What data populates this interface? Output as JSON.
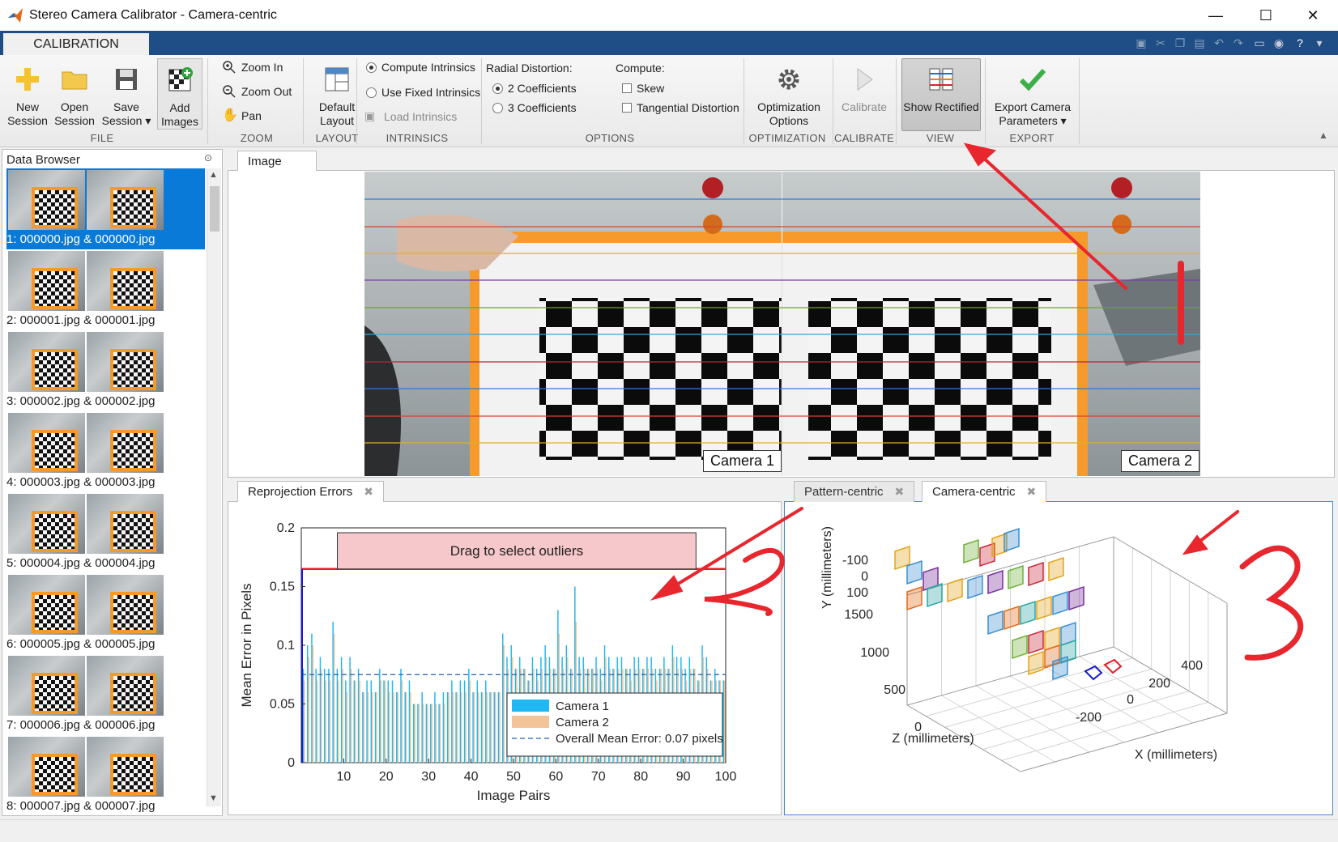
{
  "window": {
    "title": "Stereo Camera Calibrator - Camera-centric",
    "controls": [
      "—",
      "☐",
      "✕"
    ]
  },
  "ribbon": {
    "tab": "CALIBRATION",
    "file": {
      "new": [
        "New",
        "Session"
      ],
      "open": [
        "Open",
        "Session"
      ],
      "save": [
        "Save",
        "Session ▾"
      ],
      "add": [
        "Add",
        "Images"
      ],
      "section": "FILE"
    },
    "zoom": {
      "in": "Zoom In",
      "out": "Zoom Out",
      "pan": "Pan",
      "section": "ZOOM"
    },
    "layout": {
      "default": [
        "Default",
        "Layout"
      ],
      "section": "LAYOUT"
    },
    "intrinsics": {
      "compute": "Compute Intrinsics",
      "fixed": "Use Fixed Intrinsics",
      "load": "Load Intrinsics",
      "section": "INTRINSICS"
    },
    "options": {
      "radial": "Radial Distortion:",
      "coef2": "2 Coefficients",
      "coef3": "3 Coefficients",
      "compute": "Compute:",
      "skew": "Skew",
      "tangential": "Tangential Distortion",
      "section": "OPTIONS"
    },
    "optimization": {
      "label": [
        "Optimization",
        "Options"
      ],
      "section": "OPTIMIZATION"
    },
    "calibrate": {
      "label": "Calibrate",
      "section": "CALIBRATE"
    },
    "view": {
      "label": "Show Rectified",
      "section": "VIEW"
    },
    "export": {
      "label": [
        "Export Camera",
        "Parameters ▾"
      ],
      "section": "EXPORT"
    }
  },
  "data_browser": {
    "title": "Data Browser",
    "items": [
      "1: 000000.jpg & 000000.jpg",
      "2: 000001.jpg & 000001.jpg",
      "3: 000002.jpg & 000002.jpg",
      "4: 000003.jpg & 000003.jpg",
      "5: 000004.jpg & 000004.jpg",
      "6: 000005.jpg & 000005.jpg",
      "7: 000006.jpg & 000006.jpg",
      "8: 000007.jpg & 000007.jpg"
    ]
  },
  "image_panel": {
    "tab": "Image",
    "camera1": "Camera 1",
    "camera2": "Camera 2"
  },
  "reprojection": {
    "tab": "Reprojection Errors",
    "close": "✖",
    "drag": "Drag to select outliers",
    "ylabel": "Mean Error in Pixels",
    "xlabel": "Image Pairs",
    "legend": [
      "Camera 1",
      "Camera 2",
      "Overall Mean Error: 0.07 pixels"
    ],
    "yticks": [
      "0.2",
      "0.15",
      "0.1",
      "0.05",
      "0"
    ],
    "xticks": [
      "10",
      "20",
      "30",
      "40",
      "50",
      "60",
      "70",
      "80",
      "90",
      "100"
    ]
  },
  "extrinsics": {
    "tab_pattern": "Pattern-centric",
    "tab_camera": "Camera-centric",
    "close": "✖",
    "ylabel": "Y (millimeters)",
    "zlabel": "Z (millimeters)",
    "xlabel": "X (millimeters)",
    "yticks": [
      "-100",
      "0",
      "100"
    ],
    "zticks": [
      "1500",
      "1000",
      "500",
      "0"
    ],
    "xticks": [
      "-200",
      "0",
      "200",
      "400"
    ]
  },
  "annotations": {
    "num2": "2",
    "num3": "3"
  },
  "chart_data": {
    "type": "bar",
    "title": "",
    "xlabel": "Image Pairs",
    "ylabel": "Mean Error in Pixels",
    "ylim": [
      0,
      0.2
    ],
    "xlim": [
      0,
      100
    ],
    "overall_mean": 0.075,
    "threshold": 0.165,
    "series": [
      {
        "name": "Camera 1",
        "color": "#1fb8f2",
        "values": [
          0.08,
          0.1,
          0.11,
          0.08,
          0.09,
          0.08,
          0.08,
          0.12,
          0.08,
          0.09,
          0.07,
          0.09,
          0.07,
          0.08,
          0.06,
          0.07,
          0.07,
          0.06,
          0.08,
          0.07,
          0.07,
          0.07,
          0.06,
          0.08,
          0.06,
          0.07,
          0.05,
          0.05,
          0.06,
          0.05,
          0.05,
          0.06,
          0.05,
          0.06,
          0.06,
          0.07,
          0.06,
          0.07,
          0.07,
          0.08,
          0.06,
          0.07,
          0.06,
          0.07,
          0.06,
          0.06,
          0.06,
          0.11,
          0.09,
          0.1,
          0.08,
          0.09,
          0.08,
          0.07,
          0.09,
          0.08,
          0.09,
          0.1,
          0.09,
          0.08,
          0.13,
          0.09,
          0.1,
          0.08,
          0.15,
          0.09,
          0.09,
          0.08,
          0.08,
          0.09,
          0.08,
          0.1,
          0.09,
          0.08,
          0.09,
          0.09,
          0.08,
          0.08,
          0.09,
          0.09,
          0.08,
          0.09,
          0.09,
          0.08,
          0.08,
          0.09,
          0.08,
          0.1,
          0.09,
          0.09,
          0.08,
          0.09,
          0.08,
          0.07,
          0.1,
          0.09,
          0.07,
          0.08,
          0.07,
          0.07
        ]
      },
      {
        "name": "Camera 2",
        "color": "#f3c39a",
        "values": [
          0.07,
          0.09,
          0.1,
          0.07,
          0.08,
          0.07,
          0.07,
          0.11,
          0.07,
          0.08,
          0.06,
          0.08,
          0.07,
          0.07,
          0.06,
          0.06,
          0.06,
          0.06,
          0.07,
          0.07,
          0.06,
          0.06,
          0.06,
          0.07,
          0.06,
          0.06,
          0.05,
          0.05,
          0.05,
          0.05,
          0.05,
          0.05,
          0.05,
          0.05,
          0.06,
          0.06,
          0.06,
          0.06,
          0.06,
          0.07,
          0.06,
          0.06,
          0.06,
          0.06,
          0.06,
          0.06,
          0.06,
          0.1,
          0.08,
          0.09,
          0.08,
          0.08,
          0.08,
          0.07,
          0.08,
          0.07,
          0.08,
          0.09,
          0.08,
          0.08,
          0.11,
          0.08,
          0.09,
          0.08,
          0.12,
          0.08,
          0.08,
          0.08,
          0.08,
          0.08,
          0.07,
          0.09,
          0.08,
          0.08,
          0.08,
          0.08,
          0.08,
          0.07,
          0.08,
          0.08,
          0.08,
          0.08,
          0.08,
          0.07,
          0.08,
          0.08,
          0.08,
          0.09,
          0.08,
          0.08,
          0.07,
          0.08,
          0.08,
          0.07,
          0.09,
          0.08,
          0.07,
          0.07,
          0.07,
          0.07
        ]
      }
    ]
  }
}
